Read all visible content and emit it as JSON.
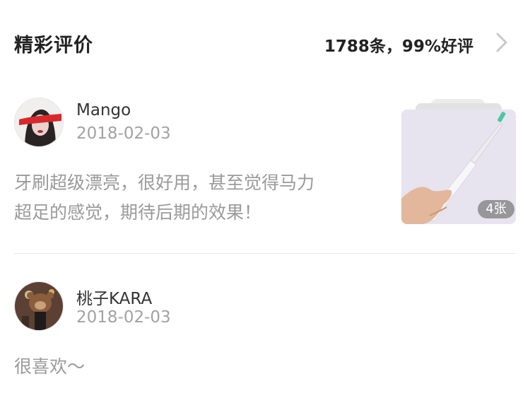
{
  "header": {
    "title": "精彩评价",
    "summary": "1788条，99%好评",
    "chevron_icon": "chevron-right-icon"
  },
  "reviews": [
    {
      "avatar_icon": "user-avatar",
      "username": "Mango",
      "date": "2018-02-03",
      "text": "牙刷超级漂亮，很好用，甚至觉得马力\n超足的感觉，期待后期的效果！",
      "photo": {
        "icon": "toothbrush-photo",
        "count_label": "4张"
      }
    },
    {
      "avatar_icon": "user-avatar",
      "username": "桃子KARA",
      "date": "2018-02-03",
      "text": "很喜欢～"
    }
  ],
  "colors": {
    "title": "#222222",
    "secondary": "#a2a2a2",
    "content": "#9a9a9a",
    "divider": "#e6e6e6"
  }
}
